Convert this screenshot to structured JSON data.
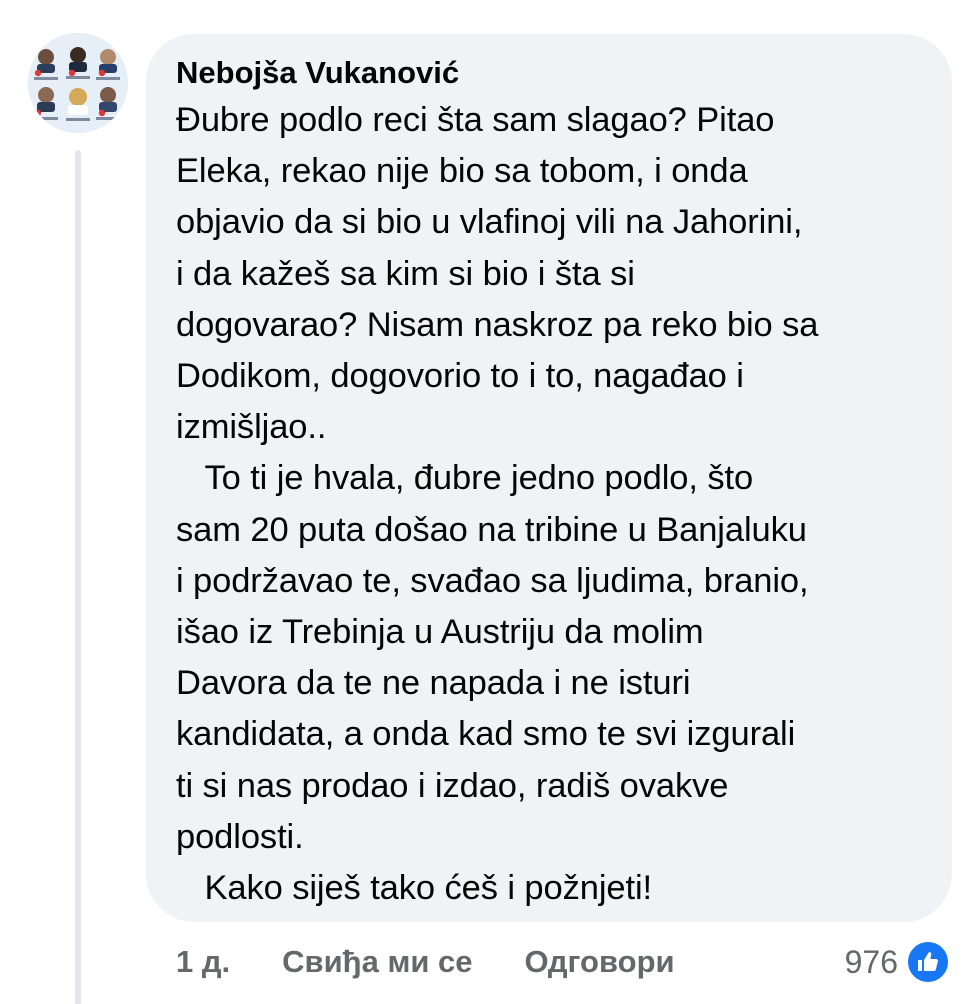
{
  "comment": {
    "author": "Nebojša Vukanović",
    "text": "Đubre podlo reci šta sam slagao? Pitao\nEleka, rekao nije bio sa tobom, i onda\nobjavio da si bio u vlafinoj vili na Jahorini,\ni da kažeš sa kim si bio i šta si\ndogovarao? Nisam naskroz pa reko bio sa\nDodikom, dogovorio to i to, nagađao i\nizmišljao..\n   To ti je hvala, đubre jedno podlo, što\nsam 20 puta došao na tribine u Banjaluku\ni podržavao te, svađao sa ljudima, branio,\nišao iz Trebinja u Austriju da molim\nDavora da te ne napada i ne isturi\nkandidata, a onda kad smo te svi izgurali\nti si nas prodao i izdao, radiš ovakve\npodlosti.\n   Kako siješ tako ćeš i požnjeti!",
    "timestamp": "1 д.",
    "like_label": "Свиђа ми се",
    "reply_label": "Одговори",
    "reaction_count": "976",
    "reaction_icon": "like-thumb-icon"
  },
  "colors": {
    "bubble_bg": "#f0f2f5",
    "text": "#050505",
    "secondary_text": "#65676b",
    "like_blue": "#1877f2"
  }
}
